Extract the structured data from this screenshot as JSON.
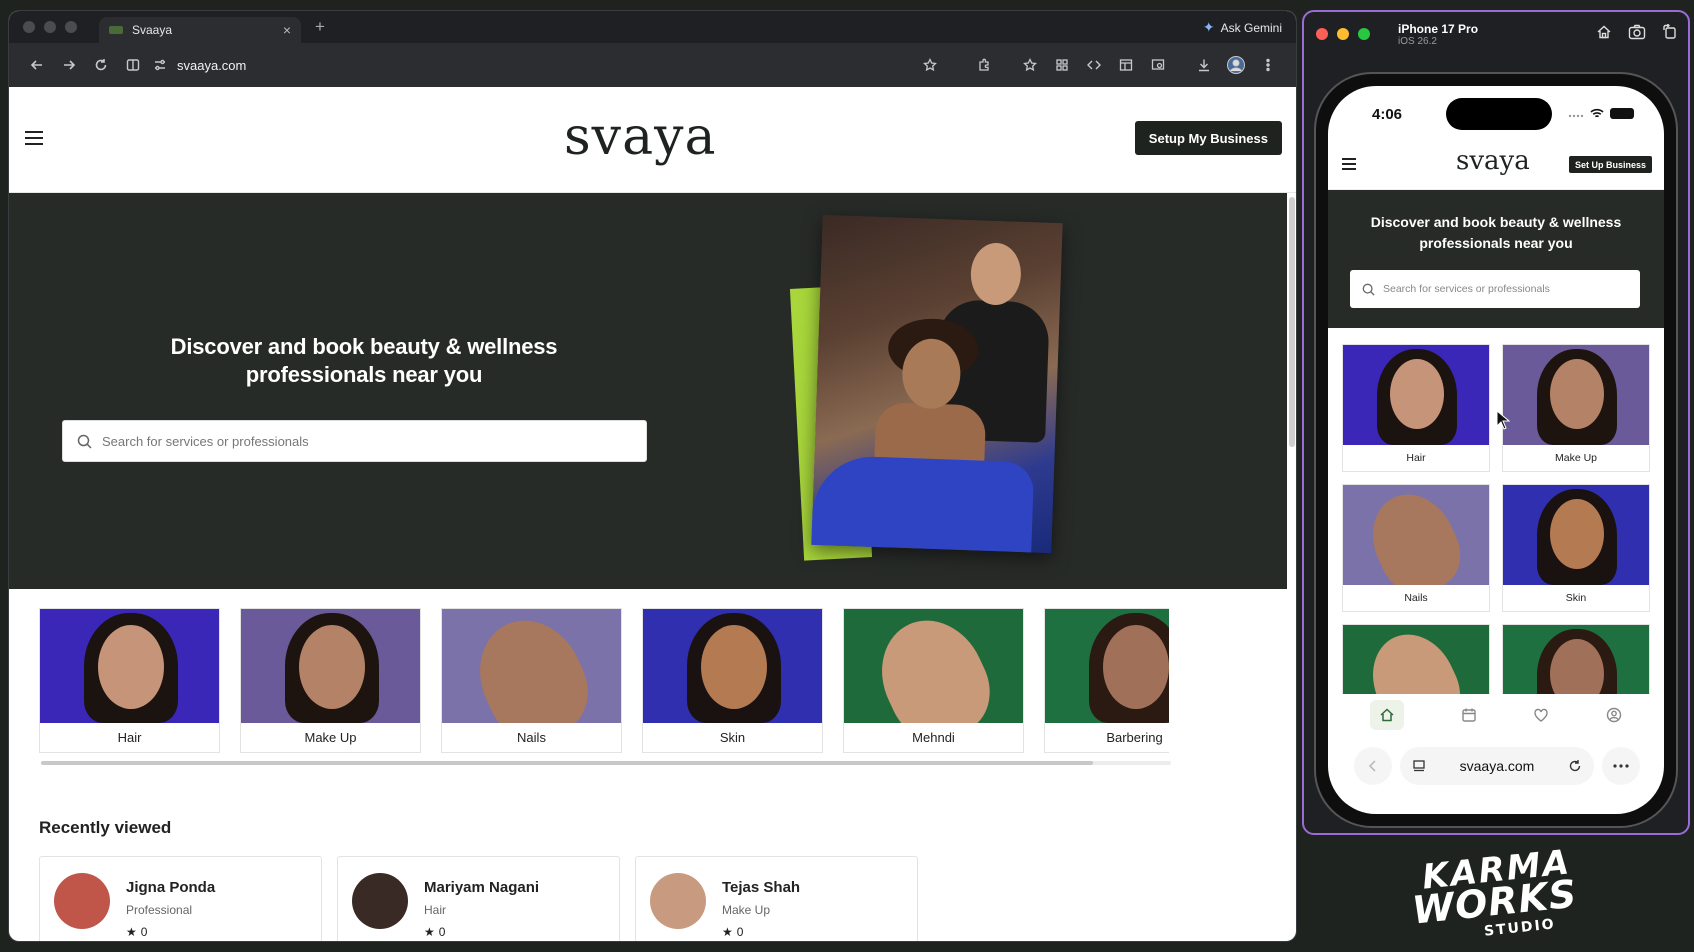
{
  "browser": {
    "tab_title": "Svaaya",
    "tab_close": "×",
    "new_tab": "+",
    "ask_gemini": "Ask Gemini",
    "url": "svaaya.com"
  },
  "site": {
    "logo": "svaya",
    "setup_button": "Setup My Business",
    "hero_title": "Discover and book beauty & wellness professionals near you",
    "search_placeholder": "Search for services or professionals",
    "categories": [
      {
        "label": "Hair",
        "bg": "#3a27b8",
        "skin": "#c69478",
        "hair": "#1a1310"
      },
      {
        "label": "Make Up",
        "bg": "#6a5a9a",
        "skin": "#b48266",
        "hair": "#1d1410"
      },
      {
        "label": "Nails",
        "bg": "#7a72a8",
        "skin": "#a8785e",
        "hair": "#a8785e"
      },
      {
        "label": "Skin",
        "bg": "#2f2fb0",
        "skin": "#b47a52",
        "hair": "#1a1210"
      },
      {
        "label": "Mehndi",
        "bg": "#1f6a3a",
        "skin": "#c89a7a",
        "hair": "#6a3a22"
      },
      {
        "label": "Barbering",
        "bg": "#1f7040",
        "skin": "#a07058",
        "hair": "#2a1a12"
      }
    ],
    "recently_viewed_title": "Recently viewed",
    "recently_viewed": [
      {
        "name": "Jigna Ponda",
        "role": "Professional",
        "rating": "0",
        "avatar_color": "#c0564a"
      },
      {
        "name": "Mariyam Nagani",
        "role": "Hair",
        "rating": "0",
        "avatar_color": "#3a2a26"
      },
      {
        "name": "Tejas Shah",
        "role": "Make Up",
        "rating": "0",
        "avatar_color": "#c89a80"
      }
    ]
  },
  "simulator": {
    "device": "iPhone 17 Pro",
    "os": "iOS 26.2",
    "time": "4:06",
    "logo": "svaya",
    "setup_button": "Set Up Business",
    "hero_title": "Discover and book beauty & wellness professionals near you",
    "search_placeholder": "Search for services or professionals",
    "categories": [
      {
        "label": "Hair"
      },
      {
        "label": "Make Up"
      },
      {
        "label": "Nails"
      },
      {
        "label": "Skin"
      },
      {
        "label": ""
      },
      {
        "label": ""
      }
    ],
    "url": "svaaya.com"
  },
  "brand": {
    "line1": "KARMA",
    "line2": "WORKS",
    "line3": "STUDIO"
  },
  "colors": {
    "dark": "#272b28",
    "accent_purple": "#9b6bd8",
    "lime": "#a8d63b"
  }
}
